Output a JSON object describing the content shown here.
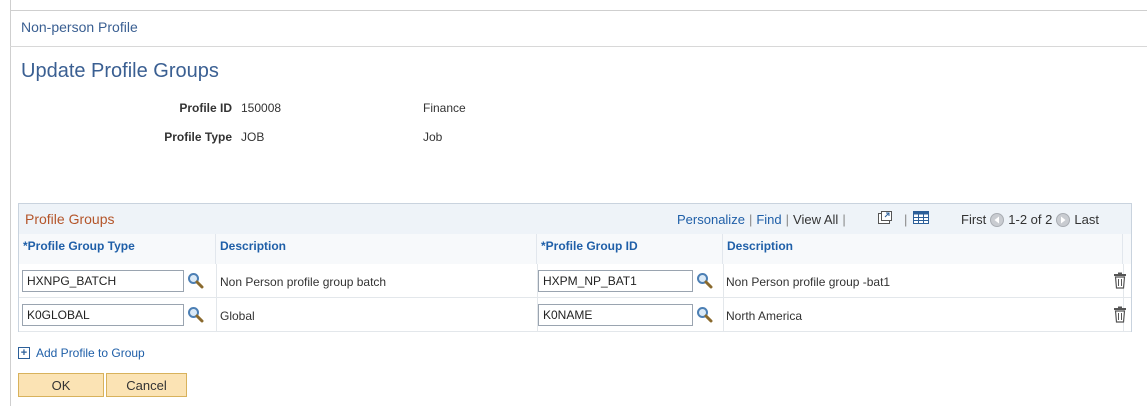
{
  "component_title": "Non-person Profile",
  "page_title": "Update Profile Groups",
  "fields": {
    "profile_id_label": "Profile ID",
    "profile_id_value": "150008",
    "profile_id_desc": "Finance",
    "profile_type_label": "Profile Type",
    "profile_type_value": "JOB",
    "profile_type_desc": "Job"
  },
  "grid": {
    "title": "Profile Groups",
    "nav": {
      "personalize": "Personalize",
      "find": "Find",
      "view_all": "View All",
      "first": "First",
      "range": "1-2 of 2",
      "last": "Last"
    },
    "columns": [
      "*Profile Group Type",
      "Description",
      "*Profile Group ID",
      "Description"
    ],
    "rows": [
      {
        "group_type": "HXNPG_BATCH",
        "type_desc": "Non Person profile group batch",
        "group_id": "HXPM_NP_BAT1",
        "id_desc": "Non Person profile group -bat1"
      },
      {
        "group_type": "K0GLOBAL",
        "type_desc": "Global",
        "group_id": "K0NAME",
        "id_desc": "North America"
      }
    ]
  },
  "add_link": "Add Profile to Group",
  "buttons": {
    "ok": "OK",
    "cancel": "Cancel"
  },
  "colors": {
    "title_blue": "#3a5f92",
    "link_blue": "#1f5fa8",
    "grid_title": "#b4552a",
    "button_bg": "#fbe3b4"
  }
}
